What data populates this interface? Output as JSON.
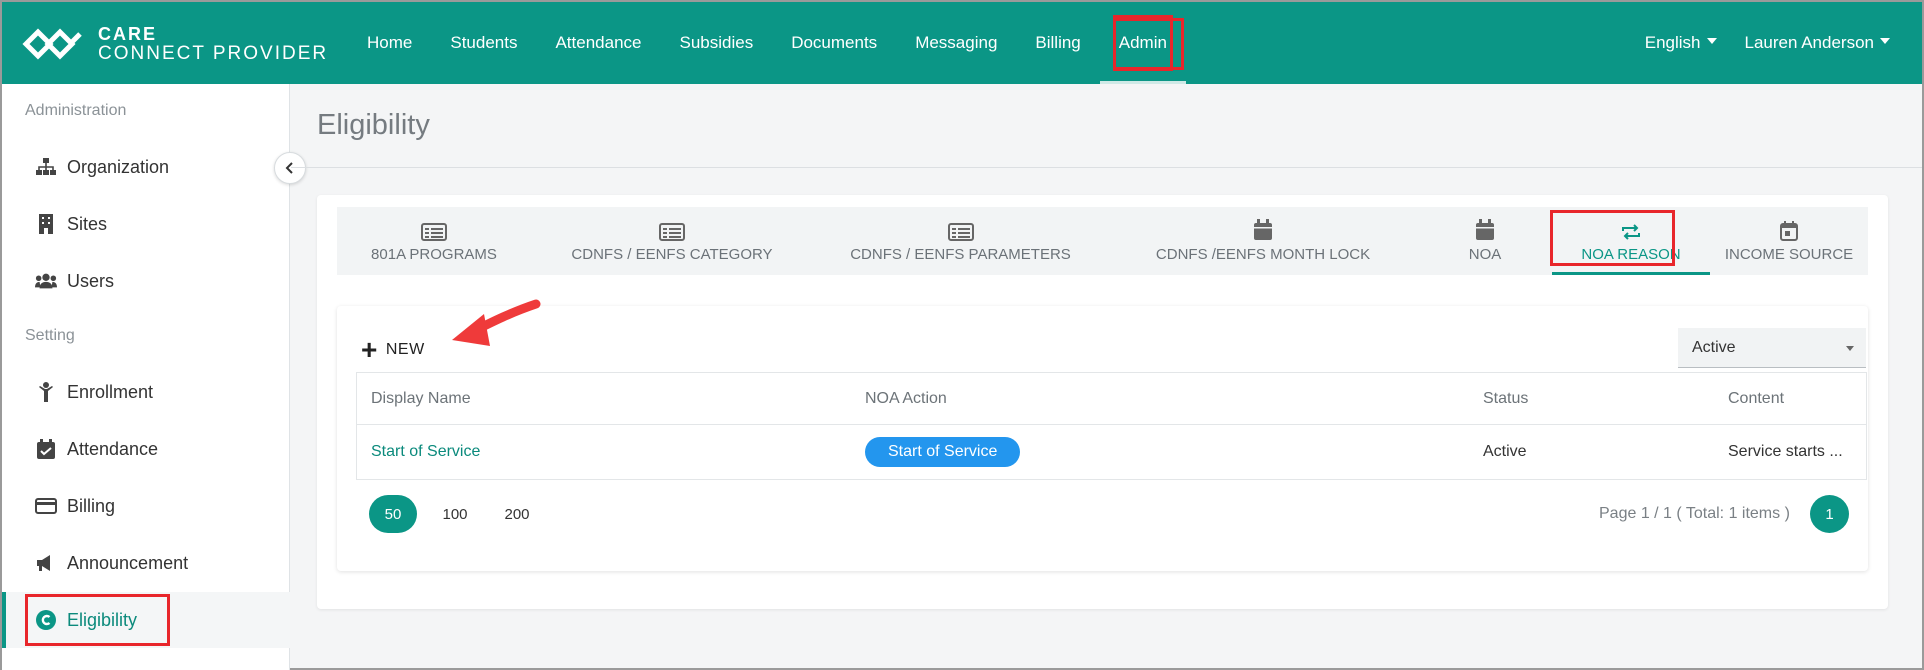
{
  "app": {
    "logo_line1": "CARE",
    "logo_line2": "CONNECT PROVIDER"
  },
  "topnav": {
    "items": [
      "Home",
      "Students",
      "Attendance",
      "Subsidies",
      "Documents",
      "Messaging",
      "Billing",
      "Admin"
    ],
    "active": "Admin",
    "language": "English",
    "user": "Lauren Anderson"
  },
  "sidebar": {
    "section1": "Administration",
    "admin_items": [
      {
        "label": "Organization",
        "icon": "sitemap-icon"
      },
      {
        "label": "Sites",
        "icon": "building-icon"
      },
      {
        "label": "Users",
        "icon": "users-icon"
      }
    ],
    "section2": "Setting",
    "setting_items": [
      {
        "label": "Enrollment",
        "icon": "child-icon"
      },
      {
        "label": "Attendance",
        "icon": "calendar-check-icon"
      },
      {
        "label": "Billing",
        "icon": "credit-card-icon"
      },
      {
        "label": "Announcement",
        "icon": "megaphone-icon"
      },
      {
        "label": "Eligibility",
        "icon": "eligibility-icon"
      }
    ],
    "active": "Eligibility"
  },
  "page": {
    "title": "Eligibility"
  },
  "tabs": [
    {
      "label": "801A PROGRAMS",
      "icon": "table-icon"
    },
    {
      "label": "CDNFS / EENFS CATEGORY",
      "icon": "table-icon"
    },
    {
      "label": "CDNFS / EENFS PARAMETERS",
      "icon": "table-icon"
    },
    {
      "label": "CDNFS /EENFS MONTH LOCK",
      "icon": "calendar-icon"
    },
    {
      "label": "NOA",
      "icon": "calendar-icon"
    },
    {
      "label": "NOA REASON",
      "icon": "repeat-icon"
    },
    {
      "label": "INCOME SOURCE",
      "icon": "calendar-day-icon"
    }
  ],
  "active_tab": "NOA REASON",
  "toolbar": {
    "new_label": "NEW",
    "status_filter": "Active"
  },
  "table": {
    "columns": [
      "Display Name",
      "NOA Action",
      "Status",
      "Content"
    ],
    "rows": [
      {
        "display_name": "Start of Service",
        "noa_action": "Start of Service",
        "status": "Active",
        "content": "Service starts ..."
      }
    ]
  },
  "pagination": {
    "page_sizes": [
      "50",
      "100",
      "200"
    ],
    "selected_size": "50",
    "info": "Page 1 / 1 ( Total: 1 items )",
    "current_page": "1"
  },
  "colors": {
    "primary": "#0b9686",
    "highlight": "#e8262b",
    "pill": "#2396ee"
  }
}
